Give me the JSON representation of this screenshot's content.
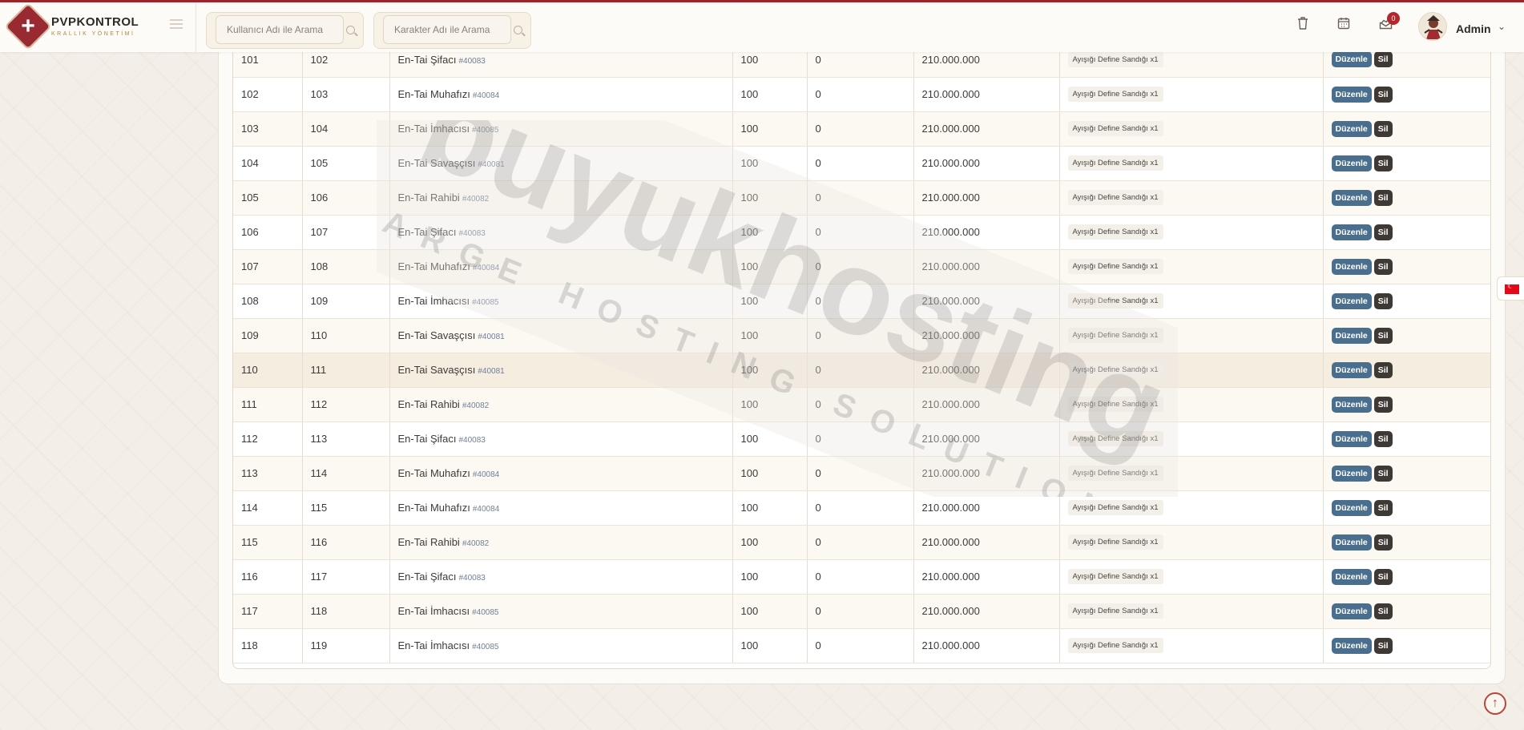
{
  "brand": {
    "title": "PVPKONTROL",
    "subtitle": "KRALLIK YÖNETİMİ"
  },
  "search": {
    "user_placeholder": "Kullanıcı Adı ile Arama",
    "char_placeholder": "Karakter Adı ile Arama"
  },
  "header": {
    "notification_count": "0",
    "admin_name": "Admin"
  },
  "icons": {
    "trash": "trash-icon",
    "calendar": "calendar-icon",
    "mail": "mail-chart-icon",
    "chevron": "chevron-down-icon",
    "flag": "turkey-flag-icon",
    "scroll_top": "arrow-up-icon"
  },
  "watermark": {
    "brand": "buyukhosting",
    "tagline": "LARGE HOSTING SOLUTIONS"
  },
  "actions": {
    "edit_label": "Düzenle",
    "delete_label": "Sil"
  },
  "colors": {
    "accent": "#a0232c",
    "edit_button": "#4a6f8e",
    "delete_button": "#3e3934"
  },
  "rows": [
    {
      "index": "101",
      "id": "102",
      "name": "En-Tai Şifacı",
      "vnum": "#40083",
      "level": "100",
      "count": "0",
      "price": "210.000.000",
      "reward": "Ayışığı Define Sandığı x1"
    },
    {
      "index": "102",
      "id": "103",
      "name": "En-Tai Muhafızı",
      "vnum": "#40084",
      "level": "100",
      "count": "0",
      "price": "210.000.000",
      "reward": "Ayışığı Define Sandığı x1"
    },
    {
      "index": "103",
      "id": "104",
      "name": "En-Tai İmhacısı",
      "vnum": "#40085",
      "level": "100",
      "count": "0",
      "price": "210.000.000",
      "reward": "Ayışığı Define Sandığı x1"
    },
    {
      "index": "104",
      "id": "105",
      "name": "En-Tai Savaşçısı",
      "vnum": "#40081",
      "level": "100",
      "count": "0",
      "price": "210.000.000",
      "reward": "Ayışığı Define Sandığı x1"
    },
    {
      "index": "105",
      "id": "106",
      "name": "En-Tai Rahibi",
      "vnum": "#40082",
      "level": "100",
      "count": "0",
      "price": "210.000.000",
      "reward": "Ayışığı Define Sandığı x1"
    },
    {
      "index": "106",
      "id": "107",
      "name": "En-Tai Şifacı",
      "vnum": "#40083",
      "level": "100",
      "count": "0",
      "price": "210.000.000",
      "reward": "Ayışığı Define Sandığı x1"
    },
    {
      "index": "107",
      "id": "108",
      "name": "En-Tai Muhafızı",
      "vnum": "#40084",
      "level": "100",
      "count": "0",
      "price": "210.000.000",
      "reward": "Ayışığı Define Sandığı x1"
    },
    {
      "index": "108",
      "id": "109",
      "name": "En-Tai İmhacısı",
      "vnum": "#40085",
      "level": "100",
      "count": "0",
      "price": "210.000.000",
      "reward": "Ayışığı Define Sandığı x1"
    },
    {
      "index": "109",
      "id": "110",
      "name": "En-Tai Savaşçısı",
      "vnum": "#40081",
      "level": "100",
      "count": "0",
      "price": "210.000.000",
      "reward": "Ayışığı Define Sandığı x1"
    },
    {
      "index": "110",
      "id": "111",
      "name": "En-Tai Savaşçısı",
      "vnum": "#40081",
      "level": "100",
      "count": "0",
      "price": "210.000.000",
      "reward": "Ayışığı Define Sandığı x1"
    },
    {
      "index": "111",
      "id": "112",
      "name": "En-Tai Rahibi",
      "vnum": "#40082",
      "level": "100",
      "count": "0",
      "price": "210.000.000",
      "reward": "Ayışığı Define Sandığı x1"
    },
    {
      "index": "112",
      "id": "113",
      "name": "En-Tai Şifacı",
      "vnum": "#40083",
      "level": "100",
      "count": "0",
      "price": "210.000.000",
      "reward": "Ayışığı Define Sandığı x1"
    },
    {
      "index": "113",
      "id": "114",
      "name": "En-Tai Muhafızı",
      "vnum": "#40084",
      "level": "100",
      "count": "0",
      "price": "210.000.000",
      "reward": "Ayışığı Define Sandığı x1"
    },
    {
      "index": "114",
      "id": "115",
      "name": "En-Tai Muhafızı",
      "vnum": "#40084",
      "level": "100",
      "count": "0",
      "price": "210.000.000",
      "reward": "Ayışığı Define Sandığı x1"
    },
    {
      "index": "115",
      "id": "116",
      "name": "En-Tai Rahibi",
      "vnum": "#40082",
      "level": "100",
      "count": "0",
      "price": "210.000.000",
      "reward": "Ayışığı Define Sandığı x1"
    },
    {
      "index": "116",
      "id": "117",
      "name": "En-Tai Şifacı",
      "vnum": "#40083",
      "level": "100",
      "count": "0",
      "price": "210.000.000",
      "reward": "Ayışığı Define Sandığı x1"
    },
    {
      "index": "117",
      "id": "118",
      "name": "En-Tai İmhacısı",
      "vnum": "#40085",
      "level": "100",
      "count": "0",
      "price": "210.000.000",
      "reward": "Ayışığı Define Sandığı x1"
    },
    {
      "index": "118",
      "id": "119",
      "name": "En-Tai İmhacısı",
      "vnum": "#40085",
      "level": "100",
      "count": "0",
      "price": "210.000.000",
      "reward": "Ayışığı Define Sandığı x1"
    }
  ]
}
